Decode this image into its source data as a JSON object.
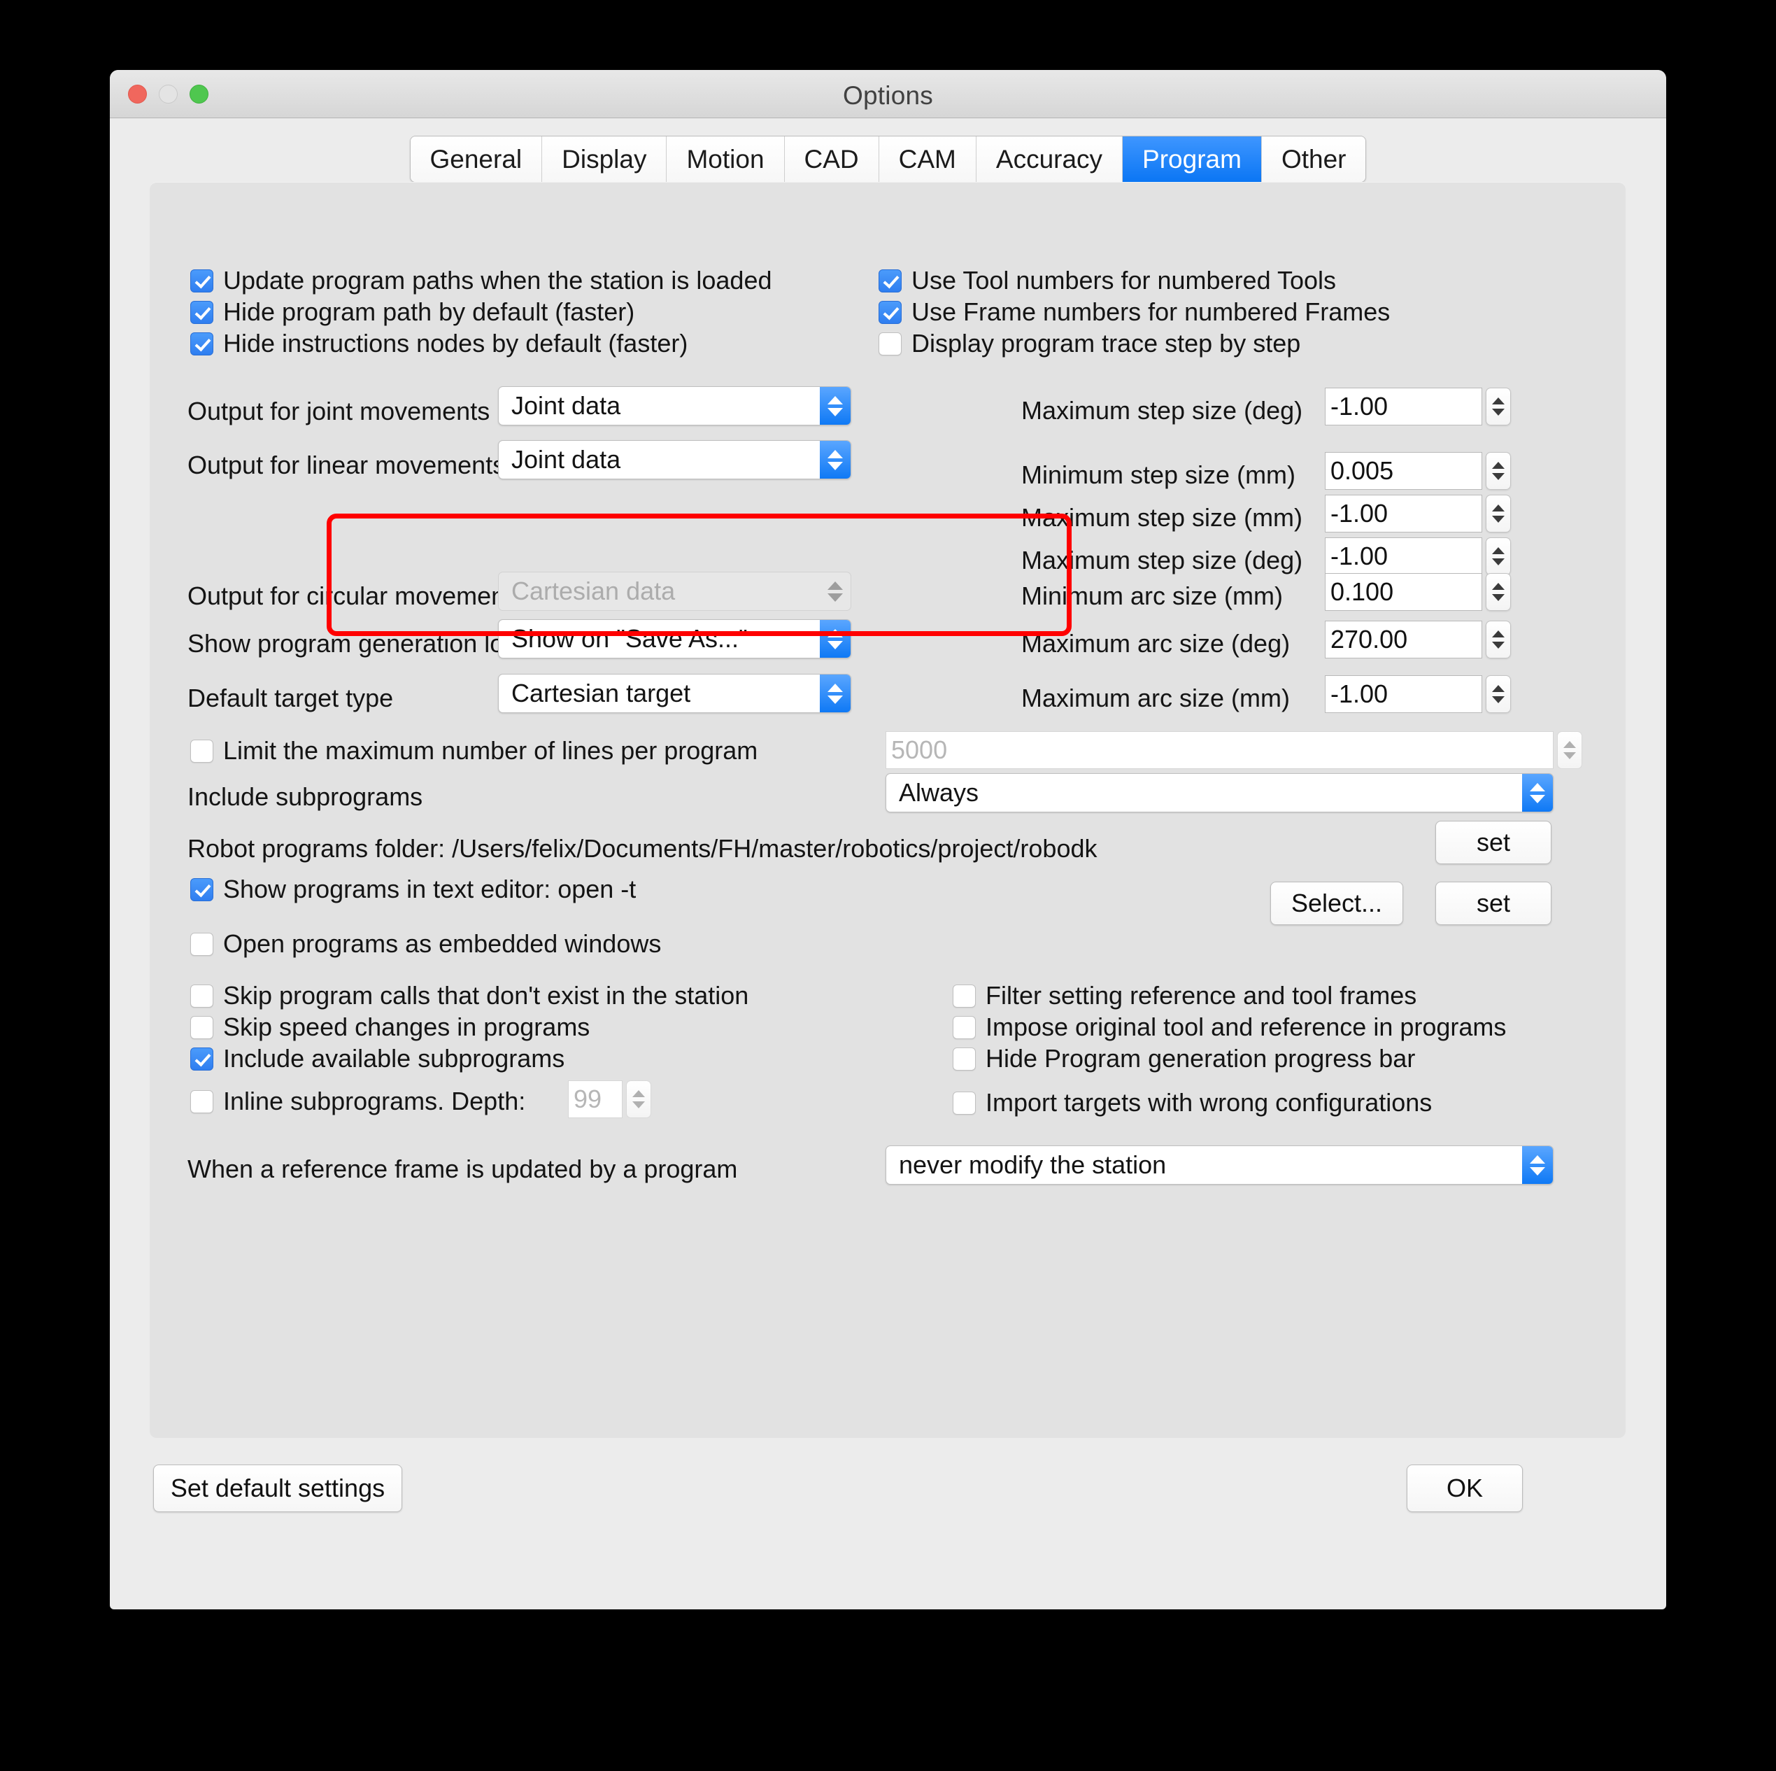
{
  "window": {
    "title": "Options",
    "traffic_lights": [
      "close",
      "minimize",
      "maximize"
    ]
  },
  "tabs": [
    {
      "label": "General",
      "active": false
    },
    {
      "label": "Display",
      "active": false
    },
    {
      "label": "Motion",
      "active": false
    },
    {
      "label": "CAD",
      "active": false
    },
    {
      "label": "CAM",
      "active": false
    },
    {
      "label": "Accuracy",
      "active": false
    },
    {
      "label": "Program",
      "active": true
    },
    {
      "label": "Other",
      "active": false
    }
  ],
  "top_checkboxes_left": [
    {
      "label": "Update program paths when the station is loaded",
      "checked": true
    },
    {
      "label": "Hide program path by default (faster)",
      "checked": true
    },
    {
      "label": "Hide instructions nodes by default (faster)",
      "checked": true
    }
  ],
  "top_checkboxes_right": [
    {
      "label": "Use Tool numbers for numbered Tools",
      "checked": true
    },
    {
      "label": "Use Frame numbers for numbered Frames",
      "checked": true
    },
    {
      "label": "Display program trace step by step",
      "checked": false
    }
  ],
  "highlighted": {
    "joint_movements": {
      "label": "Output for joint movements",
      "value": "Joint data"
    },
    "linear_movements": {
      "label": "Output for linear movements",
      "value": "Joint data"
    },
    "highlight_color": "#ff0000"
  },
  "step_sizes": [
    {
      "label": "Maximum step size (deg)",
      "value": "-1.00"
    },
    {
      "label": "Minimum step size (mm)",
      "value": "0.005"
    },
    {
      "label": "Maximum step size (mm)",
      "value": "-1.00"
    },
    {
      "label": "Maximum step size (deg)",
      "value": "-1.00"
    }
  ],
  "arc_sizes": [
    {
      "label": "Minimum arc size (mm)",
      "value": "0.100"
    },
    {
      "label": "Maximum arc size (deg)",
      "value": "270.00"
    },
    {
      "label": "Maximum arc size (mm)",
      "value": "-1.00"
    }
  ],
  "circular_movements": {
    "label": "Output for circular movements",
    "value": "Cartesian data",
    "disabled": true
  },
  "generation_log": {
    "label": "Show program generation log",
    "value": "Show on \"Save As...\""
  },
  "default_target": {
    "label": "Default target type",
    "value": "Cartesian target"
  },
  "limit_lines": {
    "label": "Limit the maximum number of lines per program",
    "checked": false,
    "placeholder": "5000"
  },
  "include_subprograms_select": {
    "label": "Include subprograms",
    "value": "Always"
  },
  "programs_folder": {
    "label": "Robot programs folder: /Users/felix/Documents/FH/master/robotics/project/robodk",
    "set_button": "set"
  },
  "text_editor": {
    "label": "Show programs in text editor:  open -t",
    "checked": true,
    "select_button": "Select...",
    "set_button": "set"
  },
  "embedded_windows": {
    "label": "Open programs as embedded windows",
    "checked": false
  },
  "lower_checkboxes_left": [
    {
      "label": "Skip program calls that don't exist in the station",
      "checked": false
    },
    {
      "label": "Skip speed changes in programs",
      "checked": false
    },
    {
      "label": "Include available subprograms",
      "checked": true
    }
  ],
  "inline_subprograms": {
    "label": "Inline subprograms. Depth:",
    "checked": false,
    "placeholder": "99"
  },
  "lower_checkboxes_right": [
    {
      "label": "Filter setting reference and tool frames",
      "checked": false
    },
    {
      "label": "Impose original tool and reference in programs",
      "checked": false
    },
    {
      "label": "Hide Program generation progress bar",
      "checked": false
    }
  ],
  "import_targets": {
    "label": "Import targets with wrong configurations",
    "checked": false
  },
  "reference_frame_update": {
    "label": "When a reference frame is updated by a program",
    "value": "never modify the station"
  },
  "footer": {
    "default_settings_button": "Set default settings",
    "ok_button": "OK"
  }
}
